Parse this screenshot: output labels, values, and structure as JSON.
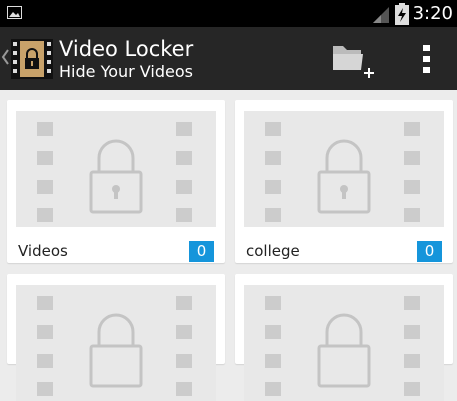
{
  "status_bar": {
    "time": "3:20",
    "icons": [
      "gallery-icon",
      "signal-icon",
      "battery-icon"
    ]
  },
  "action_bar": {
    "title": "Video Locker",
    "subtitle": "Hide Your Videos",
    "icons": [
      "back-caret-icon",
      "video-lock-logo-icon",
      "add-folder-icon",
      "overflow-menu-icon"
    ]
  },
  "folders": [
    {
      "name": "Videos",
      "count": "0"
    },
    {
      "name": "college",
      "count": "0"
    },
    {
      "name": "",
      "count": ""
    },
    {
      "name": "",
      "count": ""
    }
  ],
  "colors": {
    "status_bar": "#000000",
    "action_bar": "#262626",
    "background": "#ececec",
    "badge": "#1595db",
    "thumbnail": "#e8e8e8"
  }
}
